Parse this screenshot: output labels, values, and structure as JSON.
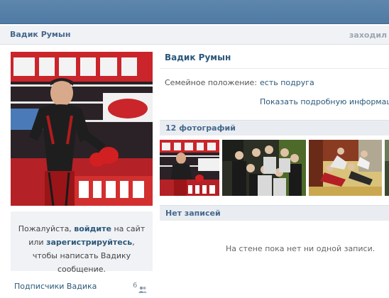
{
  "header": {
    "name": "Вадик Румын",
    "last_seen": "заходил"
  },
  "profile": {
    "name": "Вадик Румын",
    "relationship_label": "Семейное положение:",
    "relationship_value": "есть подруга",
    "show_more_link": "Показать подробную информацию"
  },
  "login_prompt": {
    "text_1": "Пожалуйста, ",
    "login_link": "войдите",
    "text_2": " на сайт или ",
    "register_link": "зарегистрируйтесь",
    "text_3": ", чтобы написать Вадику сообщение."
  },
  "subscribers": {
    "label": "Подписчики Вадика",
    "count": "6",
    "icon": "users-icon"
  },
  "photos": {
    "title": "12 фотографий",
    "items": [
      "photo-boxer-ring",
      "photo-group-men",
      "photo-gym-exercise",
      "photo-partial"
    ]
  },
  "wall": {
    "title": "Нет записей",
    "empty_text": "На стене пока нет ни одной записи."
  },
  "colors": {
    "link": "#2b587a",
    "header_bar": "#5f87ad",
    "section_bg": "#e9edf1"
  }
}
